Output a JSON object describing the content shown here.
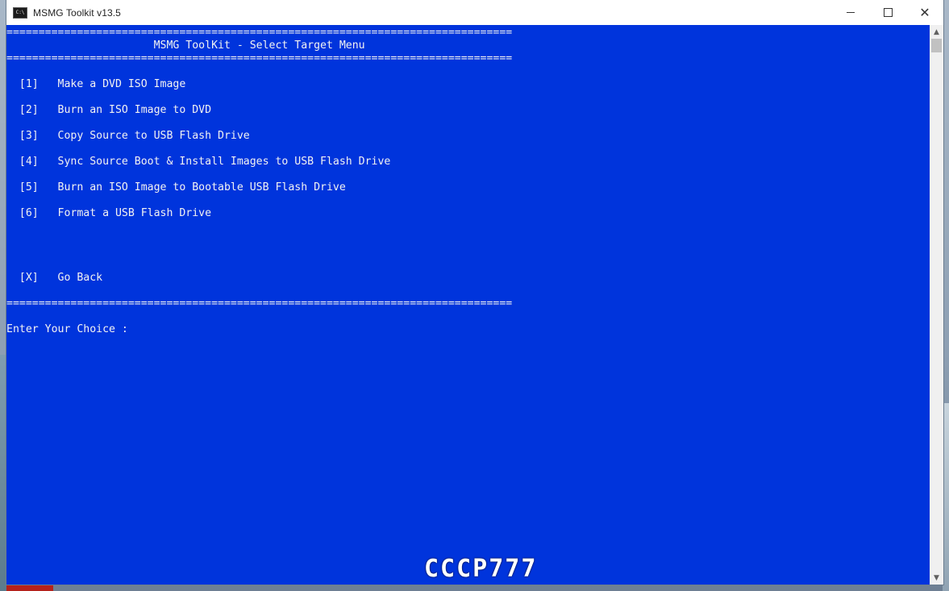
{
  "window": {
    "title": "MSMG Toolkit v13.5",
    "icon": "cmd-console-icon",
    "icon_text": "C:\\"
  },
  "console": {
    "lines": [
      "===============================================================================",
      "                       MSMG ToolKit - Select Target Menu",
      "===============================================================================",
      "",
      "  [1]   Make a DVD ISO Image",
      "",
      "  [2]   Burn an ISO Image to DVD",
      "",
      "  [3]   Copy Source to USB Flash Drive",
      "",
      "  [4]   Sync Source Boot & Install Images to USB Flash Drive",
      "",
      "  [5]   Burn an ISO Image to Bootable USB Flash Drive",
      "",
      "  [6]   Format a USB Flash Drive",
      "",
      "",
      "",
      "",
      "",
      "  [X]   Go Back",
      "",
      "===============================================================================",
      "",
      "Enter Your Choice :"
    ]
  },
  "watermark": "CCCP777",
  "colors": {
    "console_bg": "#0034dc",
    "console_fg": "#f2f2f2",
    "titlebar_bg": "#ffffff"
  }
}
